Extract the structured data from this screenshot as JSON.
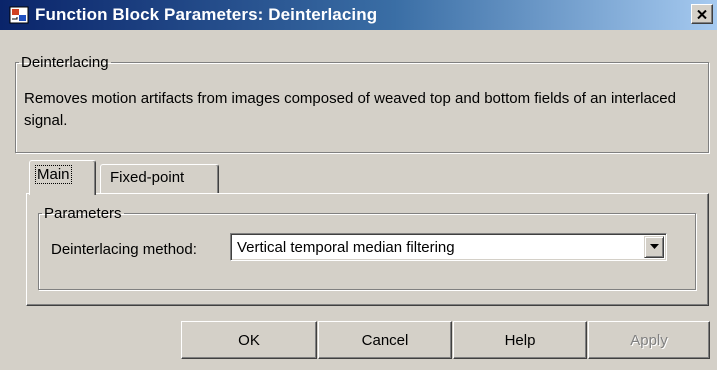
{
  "window": {
    "title": "Function Block Parameters: Deinterlacing",
    "icon": "simulink-block-icon",
    "close_icon": "close-icon"
  },
  "description_group": {
    "legend": "Deinterlacing",
    "text": "Removes motion artifacts from images composed of weaved top and bottom fields of an interlaced signal."
  },
  "tabs": [
    {
      "label": "Main",
      "selected": true
    },
    {
      "label": "Fixed-point",
      "selected": false
    }
  ],
  "parameters_group": {
    "legend": "Parameters",
    "method_label": "Deinterlacing method:",
    "method_value": "Vertical temporal median filtering",
    "dropdown_icon": "chevron-down-icon"
  },
  "buttons": {
    "ok": "OK",
    "cancel": "Cancel",
    "help": "Help",
    "apply": "Apply",
    "apply_enabled": false
  },
  "colors": {
    "titlebar_start": "#0a246a",
    "titlebar_end": "#a6caf0",
    "dialog_face": "#d4d0c8"
  }
}
